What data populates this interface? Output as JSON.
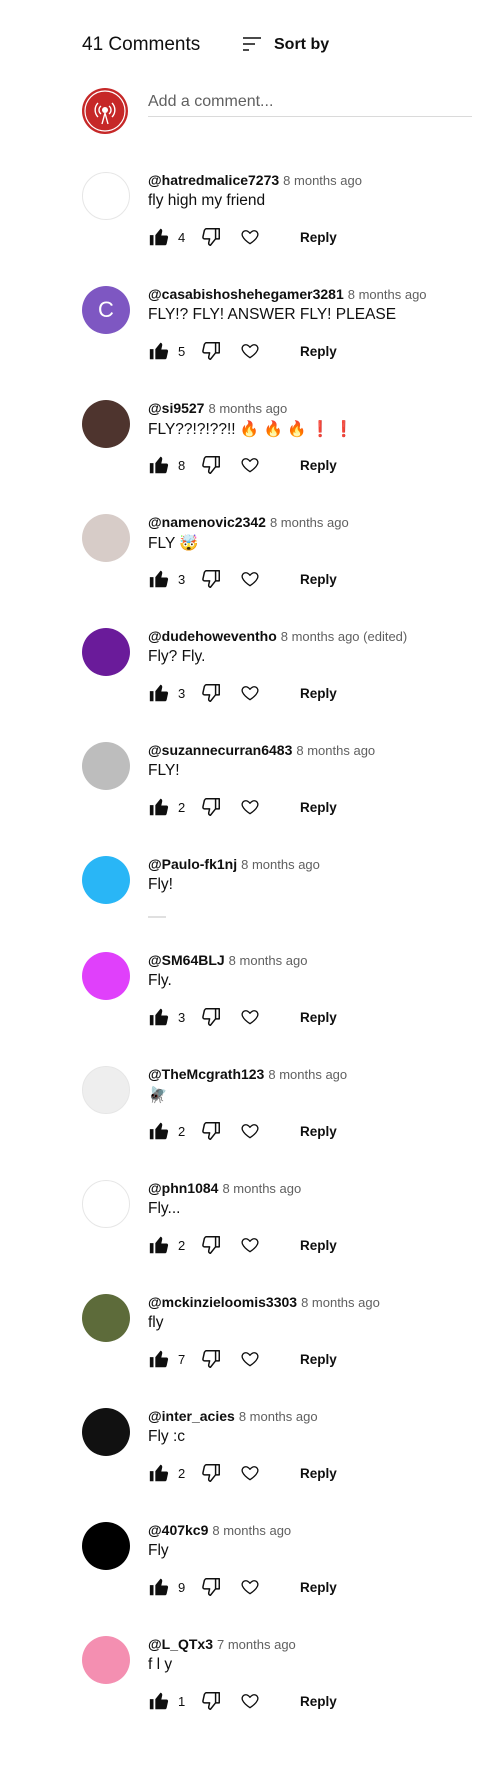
{
  "header": {
    "comment_count": "41 Comments",
    "sort_label": "Sort by"
  },
  "composer": {
    "placeholder": "Add a comment..."
  },
  "comments": [
    {
      "author": "@hatredmalice7273",
      "time": "8 months ago",
      "text": "fly high my friend",
      "likes": "4",
      "avatar_color": "#ffffff"
    },
    {
      "author": "@casabishoshehegamer3281",
      "time": "8 months ago",
      "text": "FLY!? FLY! ANSWER FLY! PLEASE",
      "likes": "5",
      "avatar_color": "#7e57c2",
      "avatar_letter": "C"
    },
    {
      "author": "@si9527",
      "time": "8 months ago",
      "text": "FLY??!?!??!! 🔥 🔥 🔥 ❗ ❗",
      "likes": "8",
      "avatar_color": "#4e342e"
    },
    {
      "author": "@namenovic2342",
      "time": "8 months ago",
      "text": "FLY 🤯",
      "likes": "3",
      "avatar_color": "#d7ccc8"
    },
    {
      "author": "@dudehoweventho",
      "time": "8 months ago (edited)",
      "text": "Fly? Fly.",
      "likes": "3",
      "avatar_color": "#6a1b9a"
    },
    {
      "author": "@suzannecurran6483",
      "time": "8 months ago",
      "text": "FLY!",
      "likes": "2",
      "avatar_color": "#bdbdbd"
    },
    {
      "author": "@Paulo-fk1nj",
      "time": "8 months ago",
      "text": "Fly!",
      "likes": "",
      "avatar_color": "#29b6f6"
    },
    {
      "author": "@SM64BLJ",
      "time": "8 months ago",
      "text": "Fly.",
      "likes": "3",
      "avatar_color": "#e040fb"
    },
    {
      "author": "@TheMcgrath123",
      "time": "8 months ago",
      "text": "🪰",
      "likes": "2",
      "avatar_color": "#eeeeee"
    },
    {
      "author": "@phn1084",
      "time": "8 months ago",
      "text": "Fly...",
      "likes": "2",
      "avatar_color": "#ffffff"
    },
    {
      "author": "@mckinzieloomis3303",
      "time": "8 months ago",
      "text": "fly",
      "likes": "7",
      "avatar_color": "#5d6b3a"
    },
    {
      "author": "@inter_acies",
      "time": "8 months ago",
      "text": "Fly :c",
      "likes": "2",
      "avatar_color": "#111111"
    },
    {
      "author": "@407kc9",
      "time": "8 months ago",
      "text": "Fly",
      "likes": "9",
      "avatar_color": "#000000"
    },
    {
      "author": "@L_QTx3",
      "time": "7 months ago",
      "text": "f l y",
      "likes": "1",
      "avatar_color": "#f48fb1"
    }
  ],
  "labels": {
    "reply": "Reply"
  },
  "icons": {
    "sort": "sort-icon",
    "like": "thumbs-up-icon",
    "dislike": "thumbs-down-icon",
    "heart": "heart-icon"
  },
  "colors": {
    "text": "#0f0f0f",
    "secondary": "#606060",
    "composer_avatar": "#c62828"
  }
}
